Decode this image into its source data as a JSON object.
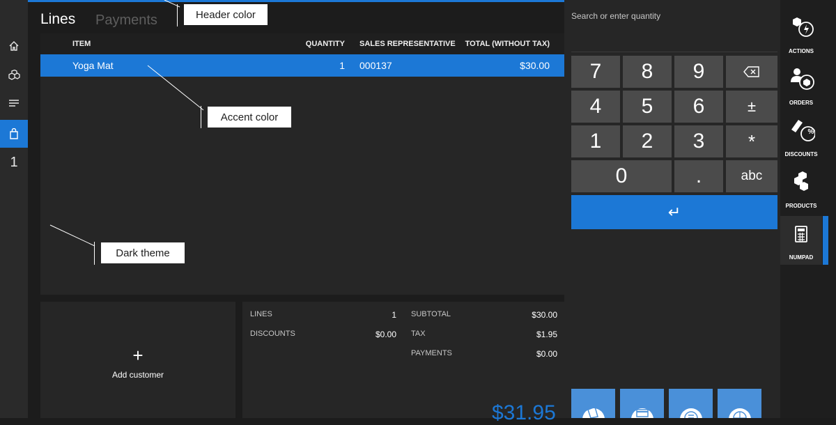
{
  "tabs": {
    "lines": "Lines",
    "payments": "Payments"
  },
  "left_nav": {
    "items": [
      {
        "icon": "home-icon"
      },
      {
        "icon": "products-icon"
      },
      {
        "icon": "menu-icon"
      },
      {
        "icon": "cart-icon",
        "active": true
      }
    ],
    "count": "1"
  },
  "lines_table": {
    "headers": {
      "item": "ITEM",
      "quantity": "QUANTITY",
      "sales_rep": "SALES REPRESENTATIVE",
      "total": "TOTAL (WITHOUT TAX)"
    },
    "rows": [
      {
        "item": "Yoga Mat",
        "quantity": "1",
        "sales_rep": "000137",
        "total": "$30.00"
      }
    ]
  },
  "customer": {
    "add_label": "Add customer",
    "add_glyph": "+"
  },
  "summary": {
    "lines_label": "LINES",
    "lines_value": "1",
    "discounts_label": "DISCOUNTS",
    "discounts_value": "$0.00",
    "subtotal_label": "SUBTOTAL",
    "subtotal_value": "$30.00",
    "tax_label": "TAX",
    "tax_value": "$1.95",
    "payments_label": "PAYMENTS",
    "payments_value": "$0.00",
    "grand_total": "$31.95"
  },
  "numpad": {
    "search_placeholder": "Search or enter quantity",
    "keys": {
      "k7": "7",
      "k8": "8",
      "k9": "9",
      "k4": "4",
      "k5": "5",
      "k6": "6",
      "plusminus": "±",
      "k1": "1",
      "k2": "2",
      "k3": "3",
      "star": "*",
      "k0": "0",
      "dot": ".",
      "abc": "abc",
      "enter": "↵"
    }
  },
  "right_bar": {
    "actions": "ACTIONS",
    "orders": "ORDERS",
    "discounts": "DISCOUNTS",
    "products": "PRODUCTS",
    "numpad": "NUMPAD",
    "discount_badge": "%"
  },
  "callouts": {
    "header_color": "Header color",
    "accent_color": "Accent color",
    "dark_theme": "Dark theme"
  },
  "colors": {
    "accent": "#1c78d6",
    "background": "#1c1c1c",
    "panel": "#262626",
    "key": "#4b4b4b"
  }
}
